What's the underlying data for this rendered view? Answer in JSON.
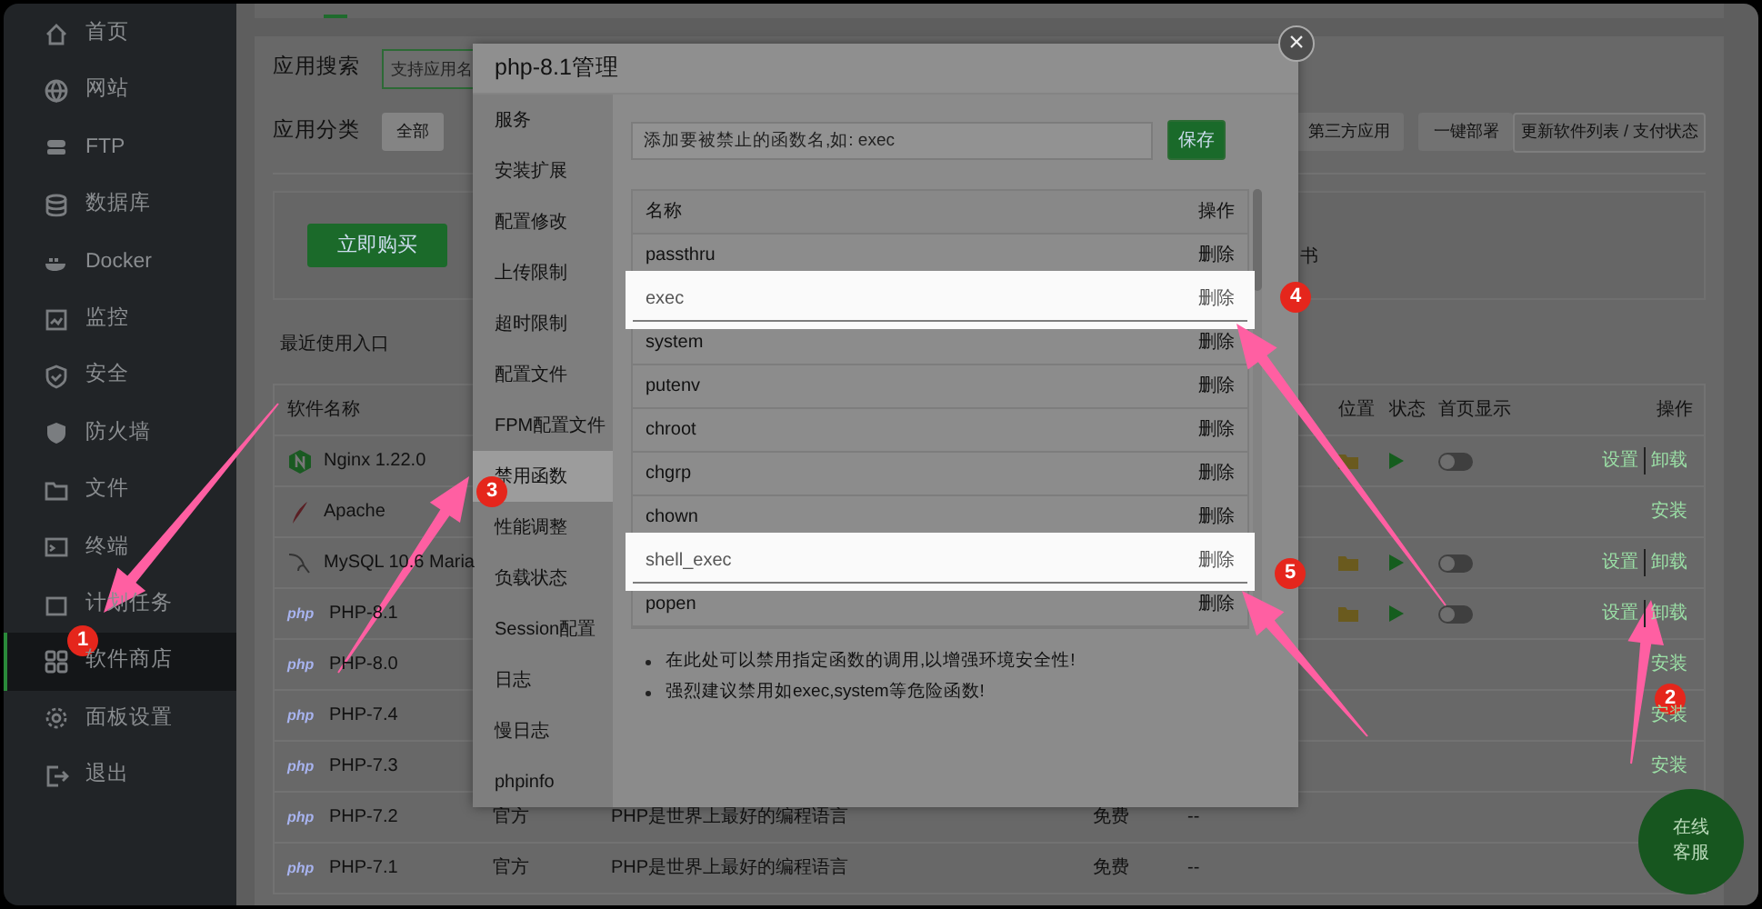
{
  "sidebar": {
    "items": [
      {
        "label": "首页",
        "selected": false
      },
      {
        "label": "网站",
        "selected": false
      },
      {
        "label": "FTP",
        "selected": false
      },
      {
        "label": "数据库",
        "selected": false
      },
      {
        "label": "Docker",
        "selected": false
      },
      {
        "label": "监控",
        "selected": false
      },
      {
        "label": "安全",
        "selected": false
      },
      {
        "label": "防火墙",
        "selected": false
      },
      {
        "label": "文件",
        "selected": false
      },
      {
        "label": "终端",
        "selected": false
      },
      {
        "label": "计划任务",
        "selected": false
      },
      {
        "label": "软件商店",
        "selected": true
      },
      {
        "label": "面板设置",
        "selected": false
      },
      {
        "label": "退出",
        "selected": false
      }
    ]
  },
  "store": {
    "search_label": "应用搜索",
    "search": {
      "placeholder": "支持应用名"
    },
    "category_label": "应用分类",
    "categories": [
      {
        "label": "全部",
        "selected": true
      },
      {
        "label": "第三方应用",
        "selected": false
      },
      {
        "label": "一键部署",
        "selected": false
      }
    ],
    "refresh_button": "更新软件列表 / 支付状态",
    "buy_button": "立即购买",
    "promo_fragment": "书",
    "recent_label": "最近使用入口",
    "table": {
      "columns": [
        "软件名称",
        "位置",
        "状态",
        "首页显示",
        "操作"
      ],
      "rows": [
        {
          "kind": "nginx",
          "name": "Nginx 1.22.0",
          "installed": true,
          "home_display": false,
          "actions": [
            "设置",
            "卸载"
          ]
        },
        {
          "kind": "apache",
          "name": "Apache",
          "installed": false,
          "actions": [
            "安装"
          ]
        },
        {
          "kind": "mysql",
          "name": "MySQL 10.6 Maria",
          "installed": true,
          "home_display": false,
          "actions": [
            "设置",
            "卸载"
          ]
        },
        {
          "kind": "php",
          "logo_text": "php",
          "name": "PHP-8.1",
          "installed": true,
          "home_display": false,
          "actions": [
            "设置",
            "卸载"
          ]
        },
        {
          "kind": "php",
          "logo_text": "php",
          "name": "PHP-8.0",
          "installed": false,
          "actions": [
            "安装"
          ]
        },
        {
          "kind": "php",
          "logo_text": "php",
          "name": "PHP-7.4",
          "installed": false,
          "actions": [
            "安装"
          ]
        },
        {
          "kind": "php",
          "logo_text": "php",
          "name": "PHP-7.3",
          "installed": false,
          "actions": [
            "安装"
          ]
        },
        {
          "kind": "php",
          "logo_text": "php",
          "name": "PHP-7.2",
          "type": "官方",
          "description": "PHP是世界上最好的编程语言",
          "price": "免费",
          "expiry": "--",
          "installed": false,
          "actions": []
        },
        {
          "kind": "php",
          "logo_text": "php",
          "name": "PHP-7.1",
          "type": "官方",
          "description": "PHP是世界上最好的编程语言",
          "price": "免费",
          "expiry": "--",
          "installed": false,
          "actions": []
        }
      ]
    }
  },
  "chat_button": "在线客服",
  "dialog": {
    "title": "php-8.1管理",
    "close": "×",
    "menu": [
      {
        "label": "服务",
        "selected": false
      },
      {
        "label": "安装扩展",
        "selected": false
      },
      {
        "label": "配置修改",
        "selected": false
      },
      {
        "label": "上传限制",
        "selected": false
      },
      {
        "label": "超时限制",
        "selected": false
      },
      {
        "label": "配置文件",
        "selected": false
      },
      {
        "label": "FPM配置文件",
        "selected": false
      },
      {
        "label": "禁用函数",
        "selected": true
      },
      {
        "label": "性能调整",
        "selected": false
      },
      {
        "label": "负载状态",
        "selected": false
      },
      {
        "label": "Session配置",
        "selected": false
      },
      {
        "label": "日志",
        "selected": false
      },
      {
        "label": "慢日志",
        "selected": false
      },
      {
        "label": "phpinfo",
        "selected": false
      }
    ],
    "input": {
      "placeholder": "添加要被禁止的函数名,如: exec"
    },
    "save_button": "保存",
    "columns": [
      "名称",
      "操作"
    ],
    "functions": [
      {
        "name": "passthru",
        "action": "删除",
        "highlighted": false
      },
      {
        "name": "exec",
        "action": "删除",
        "highlighted": true
      },
      {
        "name": "system",
        "action": "删除",
        "highlighted": false
      },
      {
        "name": "putenv",
        "action": "删除",
        "highlighted": false
      },
      {
        "name": "chroot",
        "action": "删除",
        "highlighted": false
      },
      {
        "name": "chgrp",
        "action": "删除",
        "highlighted": false
      },
      {
        "name": "chown",
        "action": "删除",
        "highlighted": false
      },
      {
        "name": "shell_exec",
        "action": "删除",
        "highlighted": true
      },
      {
        "name": "popen",
        "action": "删除",
        "highlighted": false
      }
    ],
    "notes": [
      "在此处可以禁用指定函数的调用,以增强环境安全性!",
      "强烈建议禁用如exec,system等危险函数!"
    ]
  },
  "annotations": [
    {
      "number": "1"
    },
    {
      "number": "2"
    },
    {
      "number": "3"
    },
    {
      "number": "4"
    },
    {
      "number": "5"
    }
  ]
}
